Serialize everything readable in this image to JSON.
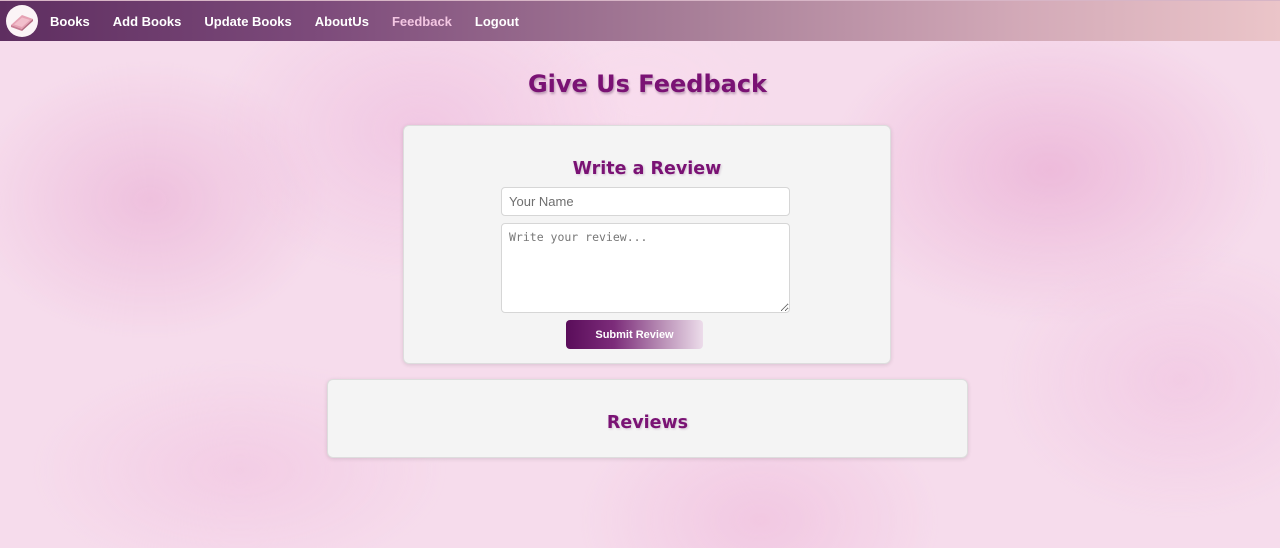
{
  "navbar": {
    "logo_icon": "book-logo-icon",
    "links": [
      {
        "label": "Books",
        "active": false
      },
      {
        "label": "Add Books",
        "active": false
      },
      {
        "label": "Update Books",
        "active": false
      },
      {
        "label": "AboutUs",
        "active": false
      },
      {
        "label": "Feedback",
        "active": true
      },
      {
        "label": "Logout",
        "active": false
      }
    ]
  },
  "page": {
    "title": "Give Us Feedback"
  },
  "review_form": {
    "heading": "Write a Review",
    "name_placeholder": "Your Name",
    "name_value": "",
    "review_placeholder": "Write your review...",
    "review_value": "",
    "submit_label": "Submit Review"
  },
  "reviews": {
    "heading": "Reviews",
    "items": []
  },
  "colors": {
    "accent": "#7a1274",
    "active_link": "#f3c6e2",
    "card_bg": "#f4f4f4"
  }
}
